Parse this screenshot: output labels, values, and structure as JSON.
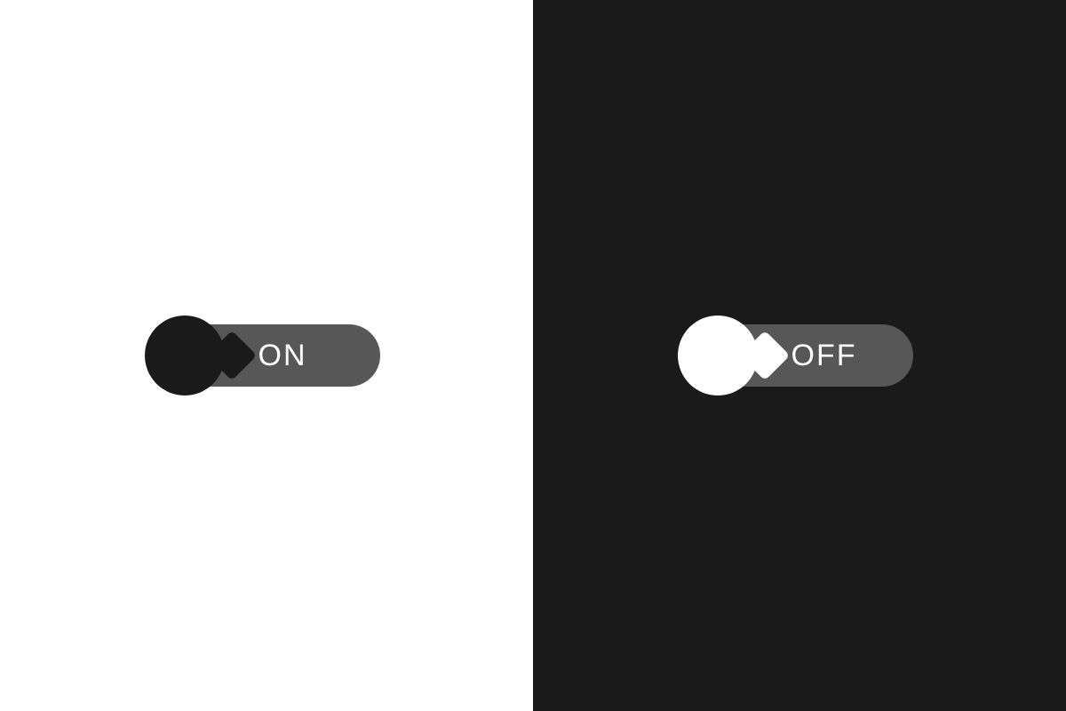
{
  "toggles": {
    "light_panel": {
      "state_label": "ON"
    },
    "dark_panel": {
      "state_label": "OFF"
    }
  },
  "colors": {
    "light_bg": "#ffffff",
    "dark_bg": "#1a1a1a",
    "track": "#575757",
    "label": "#ffffff"
  }
}
